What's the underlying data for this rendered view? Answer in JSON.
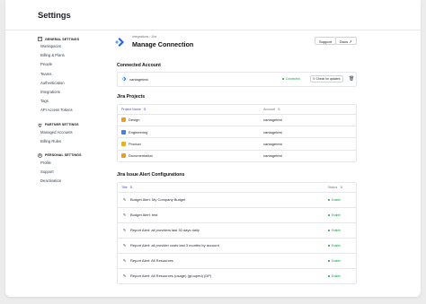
{
  "page": {
    "title": "Settings"
  },
  "sidebar": {
    "general": {
      "heading": "GENERAL SETTINGS",
      "items": [
        "Workspaces",
        "Billing & Plans",
        "People",
        "Teams",
        "Authentication",
        "Integrations",
        "Tags",
        "API Access Tokens"
      ]
    },
    "partner": {
      "heading": "PARTNER SETTINGS",
      "items": [
        "Managed Accounts",
        "Billing Rules"
      ]
    },
    "personal": {
      "heading": "PERSONAL SETTINGS",
      "items": [
        "Profile",
        "Support",
        "Deactivation"
      ]
    }
  },
  "header": {
    "breadcrumb": "Integrations  ›  Jira",
    "title": "Manage Connection",
    "support_label": "Support",
    "docs_label": "Docs ↗"
  },
  "connected": {
    "heading": "Connected Account",
    "account": "vantagetest",
    "status": "Connected",
    "check_label": "Check for updates"
  },
  "projects": {
    "heading": "Jira Projects",
    "col_name": "Project Name",
    "col_account": "Account",
    "rows": [
      {
        "name": "Design",
        "account": "vantagetest",
        "color": "#f59e0b"
      },
      {
        "name": "Engineering",
        "account": "vantagetest",
        "color": "#3b82f6"
      },
      {
        "name": "Product",
        "account": "vantagetest",
        "color": "#eab308"
      },
      {
        "name": "Documentation",
        "account": "vantagetest",
        "color": "#f59e0b"
      }
    ]
  },
  "alerts": {
    "heading": "Jira Issue Alert Configurations",
    "col_title": "Title",
    "col_status": "Status",
    "rows": [
      {
        "title": "Budget Alert: My Company Budget",
        "status": "Enable"
      },
      {
        "title": "Budget Alert: test",
        "status": "Enable"
      },
      {
        "title": "Report Alert: all providers last 30 days daily",
        "status": "Enable"
      },
      {
        "title": "Report Alert: all provider costs last 3 months by account",
        "status": "Enable"
      },
      {
        "title": "Report Alert: All Resources",
        "status": "Enable"
      },
      {
        "title": "Report Alert: All Resources (usage) (grouped) (DP)",
        "status": "Enable"
      }
    ]
  },
  "colors": {
    "accent": "#4f46e5",
    "success": "#16a34a",
    "jira": "#2563eb"
  }
}
